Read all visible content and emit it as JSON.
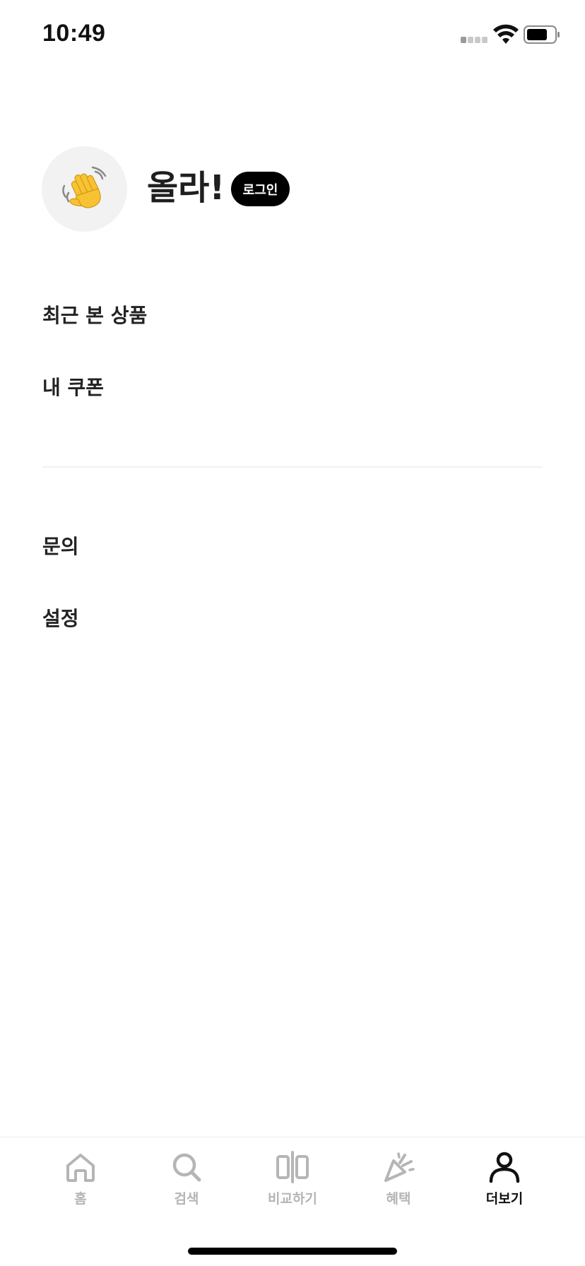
{
  "status_bar": {
    "time": "10:49",
    "icons": [
      "signal-icon",
      "wifi-icon",
      "battery-icon"
    ]
  },
  "profile": {
    "avatar_icon": "waving-hand-icon",
    "greeting": "올라!",
    "login_label": "로그인"
  },
  "menu": {
    "group1": [
      "최근 본 상품",
      "내 쿠폰"
    ],
    "group2": [
      "문의",
      "설정"
    ]
  },
  "tab_bar": {
    "tabs": [
      {
        "label": "홈",
        "icon": "home-icon",
        "active": false
      },
      {
        "label": "검색",
        "icon": "search-icon",
        "active": false
      },
      {
        "label": "비교하기",
        "icon": "compare-icon",
        "active": false
      },
      {
        "label": "혜택",
        "icon": "party-popper-icon",
        "active": false
      },
      {
        "label": "더보기",
        "icon": "person-icon",
        "active": true
      }
    ]
  },
  "colors": {
    "accent": "#000000",
    "inactive": "#b5b5b5",
    "text": "#222222",
    "avatar_bg": "#f2f2f2"
  }
}
